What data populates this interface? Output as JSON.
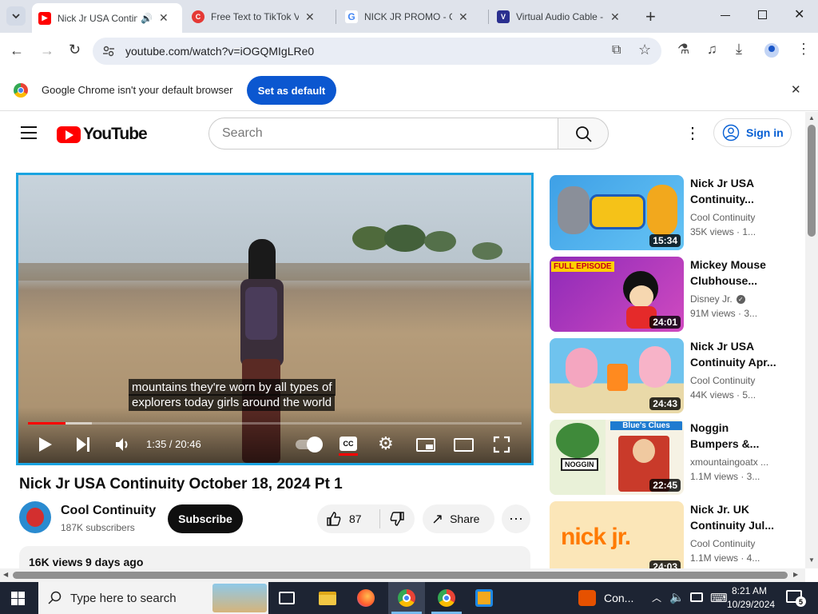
{
  "browser": {
    "tabs": [
      {
        "title": "Nick Jr USA Continuity",
        "active": true
      },
      {
        "title": "Free Text to TikTok Voice",
        "active": false
      },
      {
        "title": "NICK JR PROMO - Google",
        "active": false
      },
      {
        "title": "Virtual Audio Cable - D",
        "active": false
      }
    ],
    "url": "youtube.com/watch?v=iOGQMIgLRe0",
    "infobar_text": "Google Chrome isn't your default browser",
    "set_default_label": "Set as default"
  },
  "youtube": {
    "logo_text": "YouTube",
    "search_placeholder": "Search",
    "sign_in_label": "Sign in",
    "player": {
      "caption_line1": "mountains they're worn by all types of",
      "caption_line2": "explorers today girls around the world",
      "time": "1:35 / 20:46",
      "progress_fraction": 0.076
    },
    "video_title": "Nick Jr USA Continuity October 18, 2024 Pt 1",
    "channel_name": "Cool Continuity",
    "subscribers": "187K subscribers",
    "subscribe_label": "Subscribe",
    "likes": "87",
    "share_label": "Share",
    "views": "16K views",
    "uploaded": "9 days ago",
    "recommended": [
      {
        "title1": "Nick Jr USA",
        "title2": "Continuity...",
        "channel": "Cool Continuity",
        "meta": "35K views · 1...",
        "duration": "15:34"
      },
      {
        "title1": "Mickey Mouse",
        "title2": "Clubhouse...",
        "channel": "Disney Jr.",
        "meta": "91M views · 3...",
        "duration": "24:01",
        "thumb_text": "FULL EPISODE"
      },
      {
        "title1": "Nick Jr USA",
        "title2": "Continuity Apr...",
        "channel": "Cool Continuity",
        "meta": "44K views · 5...",
        "duration": "24:43"
      },
      {
        "title1": "Noggin",
        "title2": "Bumpers &...",
        "channel": "xmountaingoatx ...",
        "meta": "1.1M views · 3...",
        "duration": "22:45",
        "thumb_text": "Blue's Clues",
        "thumb_logo": "NOGGIN"
      },
      {
        "title1": "Nick Jr. UK",
        "title2": "Continuity Jul...",
        "channel": "Cool Continuity",
        "meta": "1.1M views · 4...",
        "duration": "24:03",
        "thumb_logo": "nick jr."
      }
    ]
  },
  "taskbar": {
    "search_placeholder": "Type here to search",
    "tray_app": "Con...",
    "time": "8:21 AM",
    "date": "10/29/2024",
    "notification_count": "5"
  }
}
